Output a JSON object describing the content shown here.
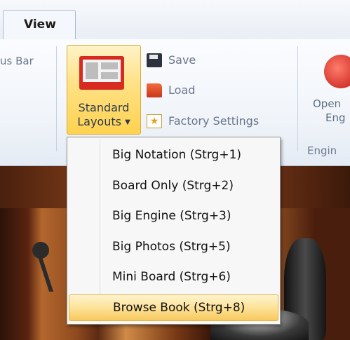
{
  "tabs": {
    "view_label": "View"
  },
  "ribbon": {
    "status_bar_label": "us Bar",
    "standard_layouts": {
      "line1": "Standard",
      "line2": "Layouts"
    },
    "save_label": "Save",
    "load_label": "Load",
    "factory_label": "Factory Settings",
    "engine_open_line1": "Open",
    "engine_open_line2": "Eng",
    "engine_group_label": "Engin"
  },
  "menu": {
    "items": [
      {
        "label": "Big Notation (Strg+1)"
      },
      {
        "label": "Board Only (Strg+2)"
      },
      {
        "label": "Big Engine (Strg+3)"
      },
      {
        "label": "Big Photos (Strg+5)"
      },
      {
        "label": "Mini Board (Strg+6)"
      },
      {
        "label": "Browse Book (Strg+8)"
      }
    ],
    "highlighted_index": 5
  },
  "colors": {
    "accent_highlight": "#fde299",
    "ribbon_bg": "#f1f5fa",
    "layout_icon": "#d72b21"
  },
  "icons": {
    "layouts": "layout-icon",
    "save": "floppy-disk-icon",
    "load": "folder-icon",
    "factory": "factory-settings-icon",
    "engine": "engine-cloud-icon",
    "dropdown": "caret-down-icon"
  }
}
